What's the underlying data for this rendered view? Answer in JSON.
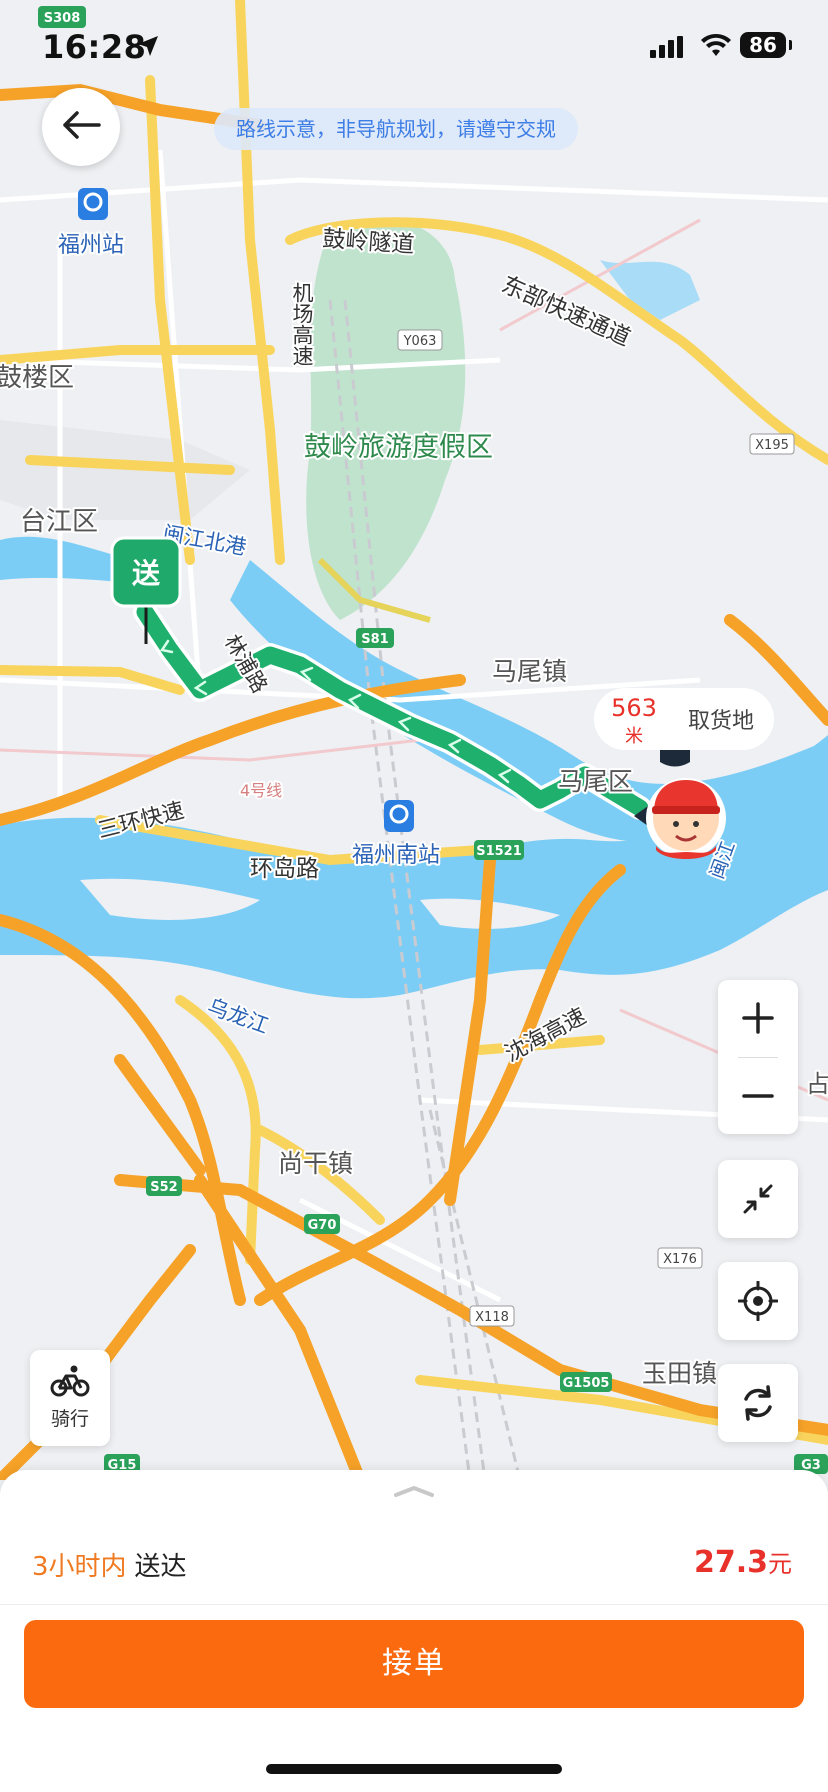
{
  "status_bar": {
    "time": "16:28",
    "battery": "86"
  },
  "notice": "路线示意，非导航规划，请遵守交规",
  "map": {
    "labels": {
      "s308": "S308",
      "fuzhou_station": "福州站",
      "guling_tunnel": "鼓岭隧道",
      "east_express": "东部快速通道",
      "airport_hwy": "机场高速",
      "y063": "Y063",
      "gulou": "鼓楼区",
      "guling_resort": "鼓岭旅游度假区",
      "x195": "X195",
      "taijiang": "台江区",
      "minjiang_north_port": "闽江北港",
      "s81": "S81",
      "linpu_road": "林浦路",
      "mawei_town": "马尾镇",
      "third_ring": "三环快速",
      "line4": "4号线",
      "mawei_district": "马尾区",
      "fuzhou_south": "福州南站",
      "s1521": "S1521",
      "huandao_road": "环岛路",
      "minjiang": "闽江",
      "wulong_river": "乌龙江",
      "shenhai_hwy": "沈海高速",
      "shanggan": "尚干镇",
      "s52": "S52",
      "g70": "G70",
      "x176": "X176",
      "x118": "X118",
      "yutian": "玉田镇",
      "g1505": "G1505",
      "g15": "G15",
      "g3": "G3",
      "zhan": "占"
    },
    "dropoff_marker": "送",
    "pickup": {
      "distance_num": "563",
      "distance_unit": "米",
      "label": "取货地"
    }
  },
  "controls": {
    "ride_mode_label": "骑行"
  },
  "order": {
    "eta_highlight": "3小时内",
    "eta_suffix": "送达",
    "price_value": "27.3",
    "price_unit": "元",
    "accept_label": "接单"
  },
  "colors": {
    "accent": "#fb6a0f",
    "price": "#e8312a",
    "route": "#1fb06e",
    "river": "#7ccdf6"
  }
}
